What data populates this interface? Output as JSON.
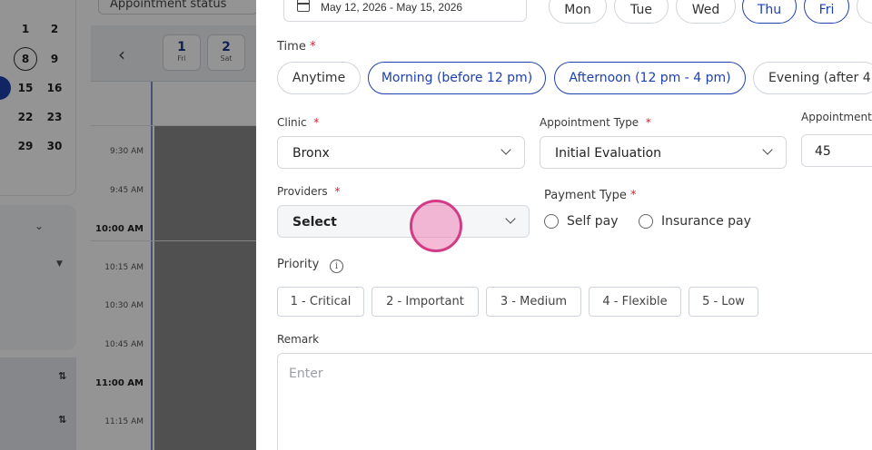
{
  "background": {
    "status_filter_label": "Appointment status",
    "mini_calendar": [
      {
        "row": [
          "1",
          "2"
        ]
      },
      {
        "row": [
          "8",
          "9"
        ]
      },
      {
        "row": [
          "15",
          "16"
        ]
      },
      {
        "row": [
          "22",
          "23"
        ]
      },
      {
        "row": [
          "29",
          "30"
        ]
      }
    ],
    "day_headers": [
      {
        "num": "1",
        "dow": "Fri"
      },
      {
        "num": "2",
        "dow": "Sat"
      }
    ],
    "time_slots": [
      "9:30 AM",
      "9:45 AM",
      "10:00 AM",
      "10:15 AM",
      "10:30 AM",
      "10:45 AM",
      "11:00 AM",
      "11:15 AM"
    ]
  },
  "form": {
    "date_range": "May 12, 2026 - May 15, 2026",
    "weekdays": [
      {
        "label": "Mon",
        "selected": false
      },
      {
        "label": "Tue",
        "selected": false
      },
      {
        "label": "Wed",
        "selected": false
      },
      {
        "label": "Thu",
        "selected": true
      },
      {
        "label": "Fri",
        "selected": true
      }
    ],
    "time": {
      "label": "Time",
      "options": [
        {
          "label": "Anytime",
          "selected": false
        },
        {
          "label": "Morning (before 12 pm)",
          "selected": true
        },
        {
          "label": "Afternoon (12 pm - 4 pm)",
          "selected": true
        },
        {
          "label": "Evening (after 4",
          "selected": false
        }
      ]
    },
    "clinic": {
      "label": "Clinic",
      "value": "Bronx"
    },
    "appointment_type": {
      "label": "Appointment Type",
      "value": "Initial Evaluation"
    },
    "appointment_duration": {
      "label": "Appointment",
      "value": "45"
    },
    "providers": {
      "label": "Providers",
      "value": "Select"
    },
    "payment_type": {
      "label": "Payment Type",
      "options": [
        "Self pay",
        "Insurance pay"
      ]
    },
    "priority": {
      "label": "Priority",
      "options": [
        "1 - Critical",
        "2 - Important",
        "3 - Medium",
        "4 - Flexible",
        "5 - Low"
      ]
    },
    "remark": {
      "label": "Remark",
      "placeholder": "Enter"
    },
    "required_mark": "*"
  },
  "colors": {
    "accent": "#1e40af",
    "required": "#d61f2c",
    "cursor": "#d23b86"
  }
}
